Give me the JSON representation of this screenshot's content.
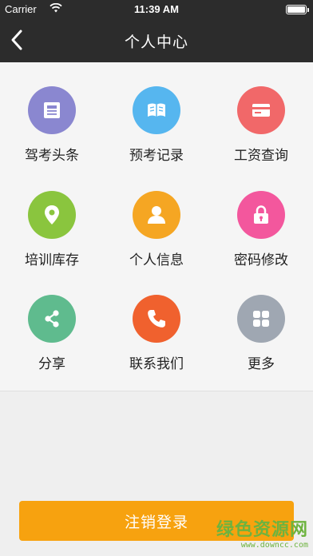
{
  "status_bar": {
    "carrier": "Carrier",
    "time": "11:39 AM"
  },
  "nav": {
    "title": "个人中心"
  },
  "grid": [
    {
      "label": "驾考头条",
      "icon": "news-icon",
      "color": "#8a87d0"
    },
    {
      "label": "预考记录",
      "icon": "book-icon",
      "color": "#56b6ef"
    },
    {
      "label": "工资查询",
      "icon": "card-icon",
      "color": "#f16869"
    },
    {
      "label": "培训库存",
      "icon": "location-pin-icon",
      "color": "#8ac53e"
    },
    {
      "label": "个人信息",
      "icon": "person-icon",
      "color": "#f5a623"
    },
    {
      "label": "密码修改",
      "icon": "lock-icon",
      "color": "#f3579d"
    },
    {
      "label": "分享",
      "icon": "share-icon",
      "color": "#5fbb8e"
    },
    {
      "label": "联系我们",
      "icon": "phone-icon",
      "color": "#f0612e"
    },
    {
      "label": "更多",
      "icon": "more-grid-icon",
      "color": "#9fa7b2"
    }
  ],
  "logout": {
    "label": "注销登录"
  },
  "watermark": {
    "text": "绿色资源网",
    "url": "www.downcc.com"
  }
}
